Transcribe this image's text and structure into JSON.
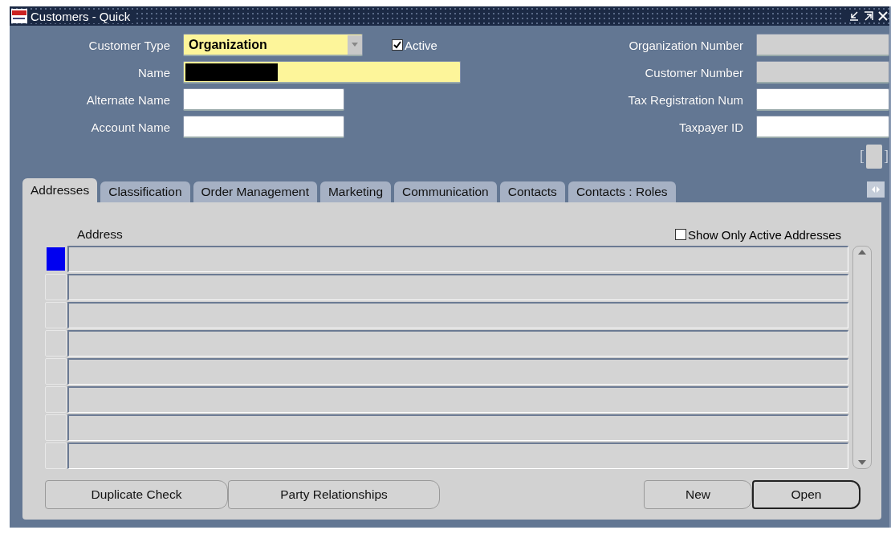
{
  "window": {
    "title": "Customers - Quick"
  },
  "header_left": [
    {
      "label": "Customer Type",
      "kind": "dropdown",
      "value": "Organization",
      "required": true
    },
    {
      "label": "Name",
      "kind": "text",
      "required": true,
      "redacted": true
    },
    {
      "label": "Alternate Name",
      "kind": "text",
      "required": false
    },
    {
      "label": "Account Name",
      "kind": "text",
      "required": false
    }
  ],
  "active": {
    "label": "Active",
    "checked": true
  },
  "header_right": [
    {
      "label": "Organization Number",
      "disabled": true
    },
    {
      "label": "Customer Number",
      "disabled": true
    },
    {
      "label": "Tax Registration Num",
      "disabled": false
    },
    {
      "label": "Taxpayer ID",
      "disabled": false
    }
  ],
  "tabs": [
    {
      "label": "Addresses",
      "selected": true
    },
    {
      "label": "Classification",
      "selected": false
    },
    {
      "label": "Order Management",
      "selected": false
    },
    {
      "label": "Marketing",
      "selected": false
    },
    {
      "label": "Communication",
      "selected": false
    },
    {
      "label": "Contacts",
      "selected": false
    },
    {
      "label": "Contacts : Roles",
      "selected": false
    }
  ],
  "address_column": "Address",
  "show_only_active": {
    "label": "Show Only Active Addresses",
    "checked": false
  },
  "address_rows": [
    {
      "selected": true
    },
    {
      "selected": false
    },
    {
      "selected": false
    },
    {
      "selected": false
    },
    {
      "selected": false
    },
    {
      "selected": false
    },
    {
      "selected": false
    },
    {
      "selected": false
    }
  ],
  "buttons_left": [
    {
      "label": "Duplicate Check",
      "default": false
    },
    {
      "label": "Party Relationships",
      "default": false
    }
  ],
  "buttons_right": [
    {
      "label": "New",
      "default": false
    },
    {
      "label": "Open",
      "default": true
    }
  ]
}
